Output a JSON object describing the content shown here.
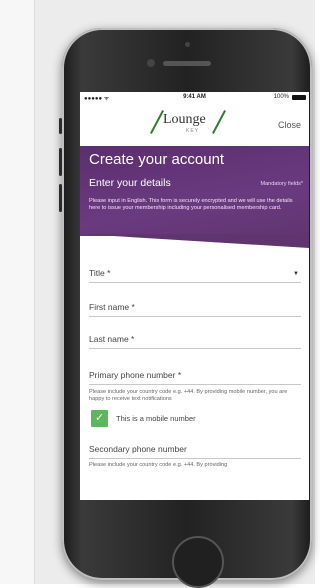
{
  "status_bar": {
    "signal": "●●●●● ᯤ",
    "time": "9:41 AM",
    "battery": "100%"
  },
  "brand": {
    "logo_text": "Lounge",
    "logo_sub": "KEY",
    "close_label": "Close"
  },
  "hero": {
    "title": "Create your account",
    "subtitle": "Enter your details",
    "mandatory": "Mandatory fields*",
    "intro": "Please input in English. This form is securely encrypted and we will use the details here to issue your membership including your personalised membership card."
  },
  "form": {
    "title_label": "Title *",
    "first_name_label": "First name *",
    "last_name_label": "Last name *",
    "primary_phone_label": "Primary phone number *",
    "primary_phone_note": "Please include your country code e.g. +44. By providing mobile number, you are happy to receive text notifications",
    "mobile_checkbox_label": "This is a mobile number",
    "mobile_checked": true,
    "secondary_phone_label": "Secondary phone number",
    "secondary_phone_note": "Please include your country code e.g. +44. By providing"
  },
  "colors": {
    "brand_purple": "#5b2f6f",
    "check_green": "#5cb85c",
    "logo_green": "#2e7d32"
  }
}
